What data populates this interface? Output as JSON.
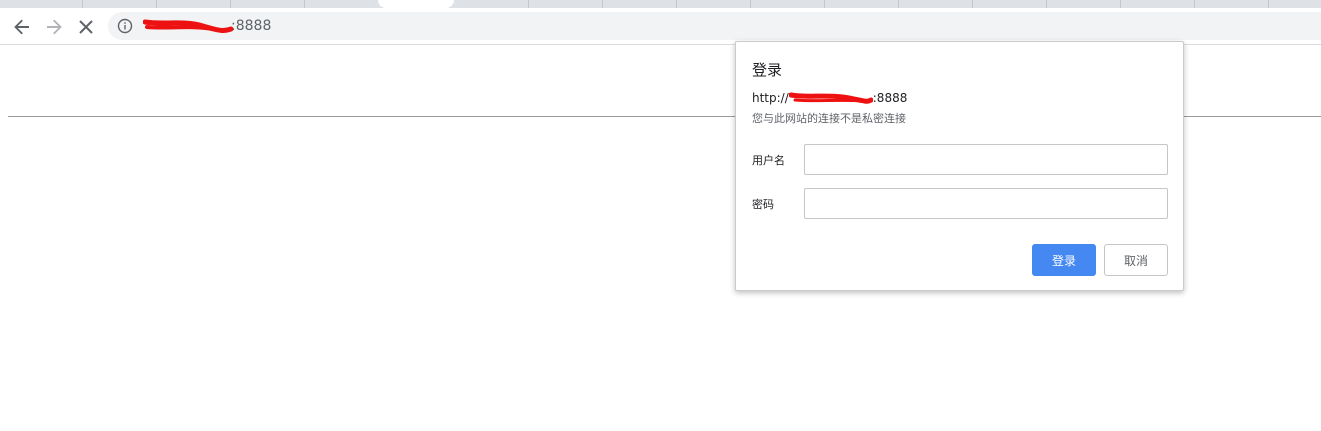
{
  "browser": {
    "url_visible_suffix": ":8888",
    "back_icon": "arrow-left-icon",
    "forward_icon": "arrow-right-icon",
    "stop_icon": "close-icon",
    "info_icon": "info-icon"
  },
  "dialog": {
    "title": "登录",
    "origin_prefix": "http://",
    "origin_suffix": ":8888",
    "warning": "您与此网站的连接不是私密连接",
    "username_label": "用户名",
    "username_value": "",
    "password_label": "密码",
    "password_value": "",
    "login_button": "登录",
    "cancel_button": "取消"
  },
  "colors": {
    "primary_button": "#4688f1",
    "redaction": "#ee1111"
  }
}
